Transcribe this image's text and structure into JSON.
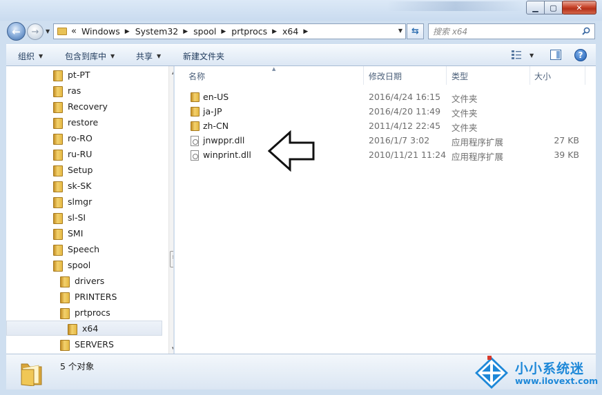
{
  "window": {
    "minimize": "▁",
    "maximize": "▢",
    "close": "✕"
  },
  "address": {
    "overflow": "«",
    "crumbs": [
      "Windows",
      "System32",
      "spool",
      "prtprocs",
      "x64"
    ],
    "search_placeholder": "搜索 x64"
  },
  "toolbar": {
    "organize": "组织",
    "include_in_library": "包含到库中",
    "share": "共享",
    "new_folder": "新建文件夹"
  },
  "nav_tree": [
    {
      "label": "pt-PT",
      "level": 1
    },
    {
      "label": "ras",
      "level": 1
    },
    {
      "label": "Recovery",
      "level": 1
    },
    {
      "label": "restore",
      "level": 1
    },
    {
      "label": "ro-RO",
      "level": 1
    },
    {
      "label": "ru-RU",
      "level": 1
    },
    {
      "label": "Setup",
      "level": 1
    },
    {
      "label": "sk-SK",
      "level": 1
    },
    {
      "label": "slmgr",
      "level": 1
    },
    {
      "label": "sl-SI",
      "level": 1
    },
    {
      "label": "SMI",
      "level": 1
    },
    {
      "label": "Speech",
      "level": 1
    },
    {
      "label": "spool",
      "level": 1
    },
    {
      "label": "drivers",
      "level": 2
    },
    {
      "label": "PRINTERS",
      "level": 2
    },
    {
      "label": "prtprocs",
      "level": 2
    },
    {
      "label": "x64",
      "level": 3,
      "selected": true
    },
    {
      "label": "SERVERS",
      "level": 2
    }
  ],
  "columns": {
    "name": "名称",
    "modified": "修改日期",
    "type": "类型",
    "size": "大小"
  },
  "files": [
    {
      "name": "en-US",
      "modified": "2016/4/24 16:15",
      "type": "文件夹",
      "size": "",
      "icon": "folder-icon"
    },
    {
      "name": "ja-JP",
      "modified": "2016/4/20 11:49",
      "type": "文件夹",
      "size": "",
      "icon": "folder-icon"
    },
    {
      "name": "zh-CN",
      "modified": "2011/4/12 22:45",
      "type": "文件夹",
      "size": "",
      "icon": "folder-icon"
    },
    {
      "name": "jnwppr.dll",
      "modified": "2016/1/7 3:02",
      "type": "应用程序扩展",
      "size": "27 KB",
      "icon": "dll-file-icon"
    },
    {
      "name": "winprint.dll",
      "modified": "2010/11/21 11:24",
      "type": "应用程序扩展",
      "size": "39 KB",
      "icon": "dll-file-icon"
    }
  ],
  "status": {
    "item_count": "5 个对象"
  },
  "watermark": {
    "title": "小小系统迷",
    "url": "www.ilovext.com"
  },
  "colors": {
    "accent": "#1e88d8",
    "folder": "#e5b944"
  }
}
